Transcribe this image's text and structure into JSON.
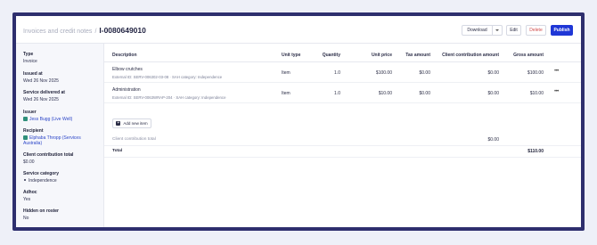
{
  "breadcrumb": {
    "parent": "Invoices and credit notes",
    "separator": "/",
    "current": "I-0080649010"
  },
  "actions": {
    "download": "Download",
    "edit": "Edit",
    "delete": "Delete",
    "publish": "Publish"
  },
  "sidebar": {
    "type": {
      "label": "Type",
      "value": "Invoice"
    },
    "issued_at": {
      "label": "Issued at",
      "value": "Wed 26 Nov 2025"
    },
    "service_delivered_at": {
      "label": "Service delivered at",
      "value": "Wed 26 Nov 2025"
    },
    "issuer": {
      "label": "Issuer",
      "value": "Jess Bugg (Live Well)"
    },
    "recipient": {
      "label": "Recipient",
      "value": "Elphaba Thropp (Services Australia)"
    },
    "client_contribution_total": {
      "label": "Client contribution total",
      "value": "$0.00"
    },
    "service_category": {
      "label": "Service category",
      "value": "Independence"
    },
    "adhoc": {
      "label": "Adhoc",
      "value": "Yes"
    },
    "hidden_on_roster": {
      "label": "Hidden on roster",
      "value": "No"
    }
  },
  "table": {
    "headers": {
      "description": "Description",
      "unit_type": "Unit type",
      "quantity": "Quantity",
      "unit_price": "Unit price",
      "tax_amount": "Tax amount",
      "client_contribution": "Client contribution amount",
      "gross_amount": "Gross amount"
    },
    "rows": [
      {
        "description": "Elbow crutches",
        "sub": "External ID: SERV-006302-03-08 · SAH category: Independence",
        "unit_type": "Item",
        "quantity": "1.0",
        "unit_price": "$100.00",
        "tax_amount": "$0.00",
        "client_contribution": "$0.00",
        "gross_amount": "$100.00"
      },
      {
        "description": "Administration",
        "sub": "External ID: SERV-0063WRAP-204 · SAH category: Independence",
        "unit_type": "Item",
        "quantity": "1.0",
        "unit_price": "$10.00",
        "tax_amount": "$0.00",
        "client_contribution": "$0.00",
        "gross_amount": "$10.00"
      }
    ],
    "add_item": "Add new item",
    "client_contribution_total": {
      "label": "Client contribution total",
      "value": "$0.00"
    },
    "total": {
      "label": "Total",
      "value": "$110.00"
    }
  }
}
